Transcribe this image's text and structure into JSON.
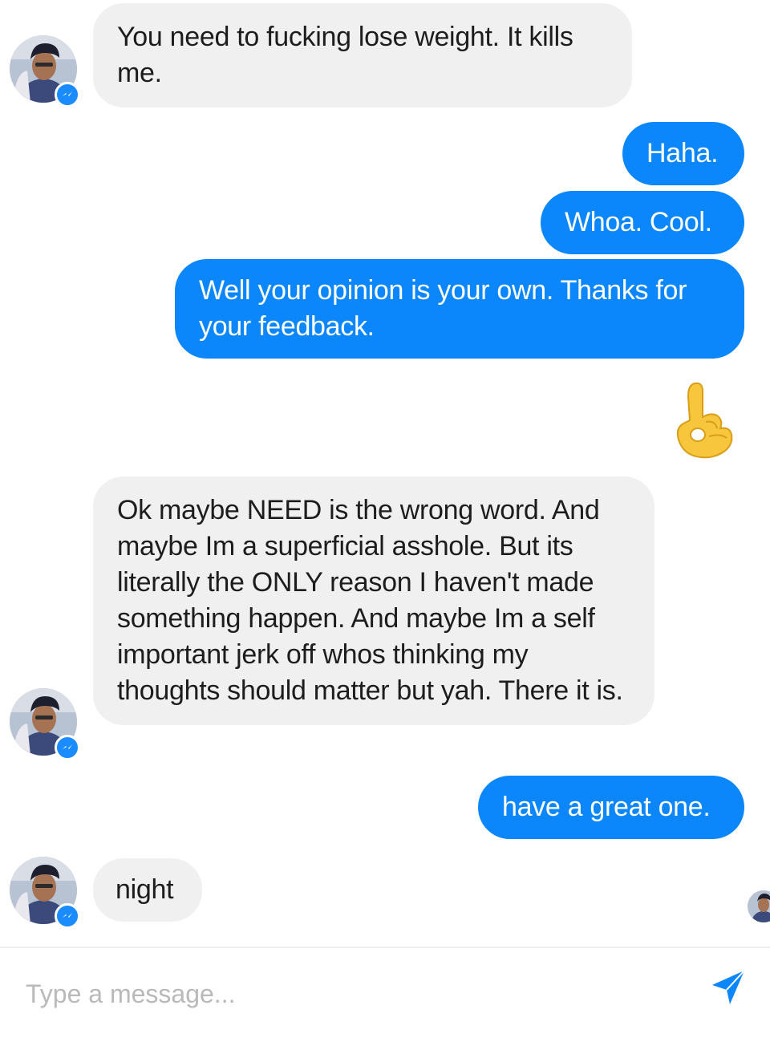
{
  "messages": {
    "m1": "You need to fucking lose weight. It kills me.",
    "m2": "Haha.",
    "m3": "Whoa. Cool.",
    "m4": "Well your opinion is your own. Thanks for your feedback.",
    "m5": "Ok maybe NEED is the wrong word. And maybe Im a superficial asshole. But its literally the ONLY reason I haven't made something happen. And maybe Im a self important jerk off whos thinking my thoughts should matter but yah. There it is.",
    "m6": "have a great one.",
    "m7": "night"
  },
  "reaction": {
    "icon": "ok-hand-emoji"
  },
  "composer": {
    "placeholder": "Type a message...",
    "send_icon": "send-arrow-icon"
  },
  "colors": {
    "outgoing_bubble": "#0b86fb",
    "incoming_bubble": "#f1f0f0",
    "messenger_badge": "#1a8cff"
  }
}
